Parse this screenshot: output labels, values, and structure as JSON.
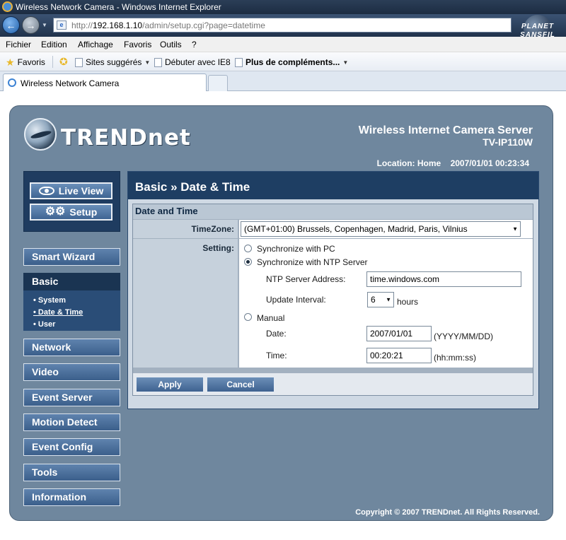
{
  "browser": {
    "window_title": "Wireless Network Camera - Windows Internet Explorer",
    "address_prefix": "http://",
    "address_host": "192.168.1.10",
    "address_path": "/admin/setup.cgi?page=datetime",
    "brand_line1": "PLANET",
    "brand_line2": "SANSFIL",
    "menu": [
      "Fichier",
      "Edition",
      "Affichage",
      "Favoris",
      "Outils",
      "?"
    ],
    "favorites": {
      "favoris": "Favoris",
      "suggested": "Sites suggérés",
      "getting_started": "Débuter avec IE8",
      "more_addons": "Plus de compléments..."
    },
    "tab_title": "Wireless Network Camera"
  },
  "camera": {
    "brand": "TRENDnet",
    "product_title": "Wireless Internet Camera Server",
    "model": "TV-IP110W",
    "location_line": "Location: Home    2007/01/01 00:23:34",
    "live_view": "Live View",
    "setup": "Setup",
    "nav": {
      "smart_wizard": "Smart Wizard",
      "basic": "Basic",
      "basic_sub": [
        "System",
        "Date & Time",
        "User"
      ],
      "network": "Network",
      "video": "Video",
      "event_server": "Event Server",
      "motion_detect": "Motion Detect",
      "event_config": "Event Config",
      "tools": "Tools",
      "information": "Information"
    },
    "page_title": "Basic » Date & Time",
    "section_title": "Date and Time",
    "timezone_label": "TimeZone:",
    "timezone_value": "(GMT+01:00) Brussels, Copenhagen, Madrid, Paris, Vilnius",
    "setting_label": "Setting:",
    "sync_pc": "Synchronize with PC",
    "sync_ntp": "Synchronize with NTP Server",
    "ntp_label": "NTP Server Address:",
    "ntp_value": "time.windows.com",
    "interval_label": "Update Interval:",
    "interval_value": "6",
    "interval_unit": "hours",
    "manual": "Manual",
    "date_label": "Date:",
    "date_value": "2007/01/01",
    "date_format": "(YYYY/MM/DD)",
    "time_label": "Time:",
    "time_value": "00:20:21",
    "time_format": "(hh:mm:ss)",
    "apply": "Apply",
    "cancel": "Cancel",
    "copyright": "Copyright © 2007 TRENDnet. All Rights Reserved.",
    "selected_setting": "Synchronize with NTP Server"
  },
  "colors": {
    "frame": "#6f879e",
    "nav_dark": "#1f3c60",
    "panel_header": "#1e3e63",
    "button": "#4f74a2"
  }
}
